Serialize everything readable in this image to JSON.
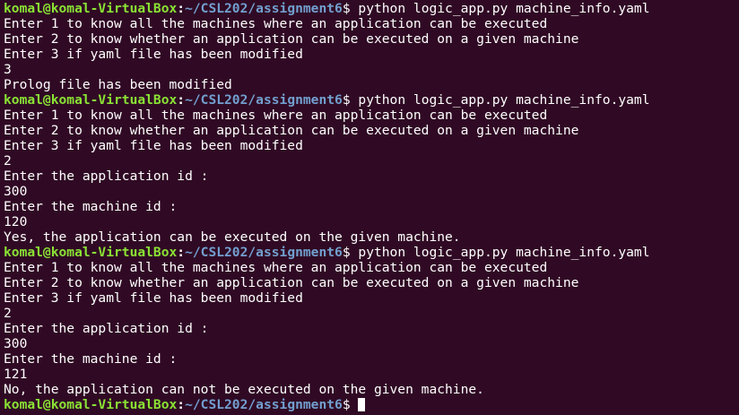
{
  "prompt": {
    "user_host": "komal@komal-VirtualBox",
    "colon": ":",
    "path": "~/CSL202/assignment6",
    "dollar": "$ ",
    "command": "python logic_app.py machine_info.yaml"
  },
  "menu": {
    "opt1": "Enter 1 to know all the machines where an application can be executed",
    "opt2": "Enter 2 to know whether an application can be executed on a given machine",
    "opt3": "Enter 3 if yaml file has been modified"
  },
  "run1": {
    "choice": "3",
    "result": "Prolog file has been modified"
  },
  "run2": {
    "choice": "2",
    "app_prompt": "Enter the application id :",
    "app_id": "300",
    "machine_prompt": "Enter the machine id :",
    "machine_id": "120",
    "result": "Yes, the application can be executed on the given machine."
  },
  "run3": {
    "choice": "2",
    "app_prompt": "Enter the application id :",
    "app_id": "300",
    "machine_prompt": "Enter the machine id :",
    "machine_id": "121",
    "result": "No, the application can not be executed on the given machine."
  },
  "colors": {
    "background": "#300a24",
    "user_host": "#8ae234",
    "path": "#729fcf",
    "text": "#ffffff"
  }
}
